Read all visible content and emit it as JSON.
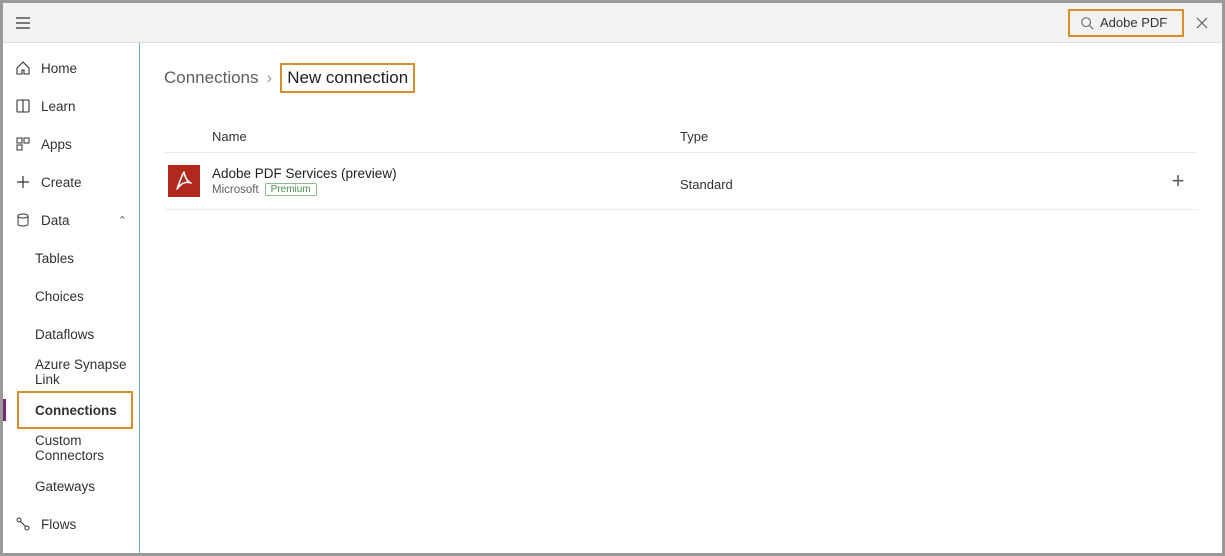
{
  "search": {
    "value": "Adobe PDF"
  },
  "sidebar": {
    "home": "Home",
    "learn": "Learn",
    "apps": "Apps",
    "create": "Create",
    "data": "Data",
    "data_items": {
      "tables": "Tables",
      "choices": "Choices",
      "dataflows": "Dataflows",
      "synapse": "Azure Synapse Link",
      "connections": "Connections",
      "custom": "Custom Connectors",
      "gateways": "Gateways"
    },
    "flows": "Flows"
  },
  "breadcrumb": {
    "parent": "Connections",
    "current": "New connection"
  },
  "table": {
    "headers": {
      "name": "Name",
      "type": "Type"
    },
    "rows": [
      {
        "name": "Adobe PDF Services (preview)",
        "publisher": "Microsoft",
        "badge": "Premium",
        "type": "Standard"
      }
    ]
  }
}
